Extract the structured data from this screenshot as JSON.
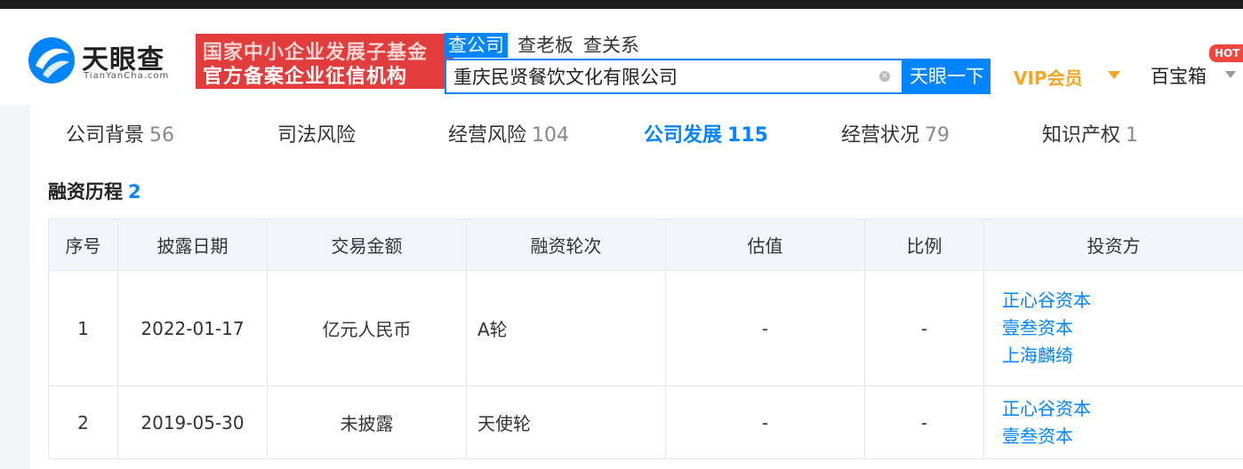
{
  "header": {
    "logo_text": "天眼查",
    "logo_sub": "TianYanCha.com",
    "banner_line1": "国家中小企业发展子基金",
    "banner_line2": "官方备案企业征信机构",
    "search_tabs": [
      "查公司",
      "查老板",
      "查关系"
    ],
    "search_value": "重庆民贤餐饮文化有限公司",
    "search_button": "天眼一下",
    "vip_label": "VIP会员",
    "baobao_label": "百宝箱",
    "hot_badge": "HOT"
  },
  "nav_tabs": [
    {
      "label": "公司背景",
      "count": "56"
    },
    {
      "label": "司法风险",
      "count": ""
    },
    {
      "label": "经营风险",
      "count": "104"
    },
    {
      "label": "公司发展",
      "count": "115"
    },
    {
      "label": "经营状况",
      "count": "79"
    },
    {
      "label": "知识产权",
      "count": "1"
    }
  ],
  "section": {
    "title": "融资历程",
    "count": "2"
  },
  "table": {
    "headers": [
      "序号",
      "披露日期",
      "交易金额",
      "融资轮次",
      "估值",
      "比例",
      "投资方"
    ],
    "rows": [
      {
        "index": "1",
        "date": "2022-01-17",
        "amount": "亿元人民币",
        "round": "A轮",
        "valuation": "-",
        "ratio": "-",
        "investors": [
          "正心谷资本",
          "壹叁资本",
          "上海麟绮"
        ]
      },
      {
        "index": "2",
        "date": "2019-05-30",
        "amount": "未披露",
        "round": "天使轮",
        "valuation": "-",
        "ratio": "-",
        "investors": [
          "正心谷资本",
          "壹叁资本"
        ]
      }
    ]
  },
  "colors": {
    "accent": "#0084ff",
    "banner": "#e33c3c",
    "vip": "#f6a623",
    "hot": "#f2453d"
  }
}
